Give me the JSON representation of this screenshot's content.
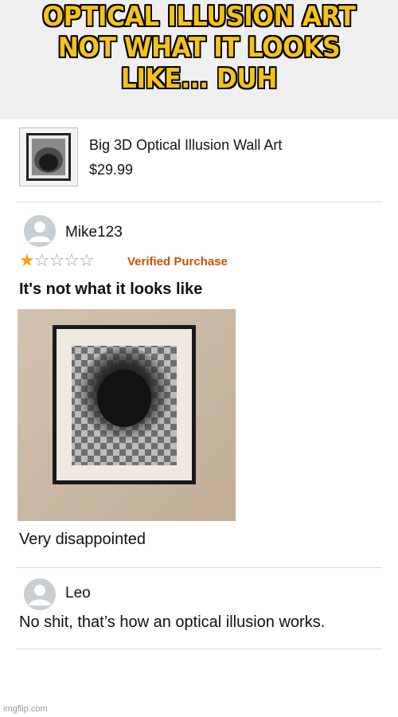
{
  "meme": {
    "caption": "OPTICAL ILLUSION ART NOT WHAT IT LOOKS LIKE... DUH",
    "caption_color": "#f6c21a"
  },
  "product": {
    "title": "Big 3D Optical Illusion Wall Art",
    "price": "$29.99"
  },
  "review": {
    "reviewer": "Mike123",
    "rating": 1,
    "rating_max": 5,
    "verified_label": "Verified Purchase",
    "title": "It's not what it looks like",
    "body": "Very disappointed"
  },
  "reply": {
    "reviewer": "Leo",
    "body": "No shit, that’s how an optical illusion works."
  },
  "watermark": "imgflip.com",
  "colors": {
    "star": "#f0a31a",
    "verified": "#c45500"
  }
}
